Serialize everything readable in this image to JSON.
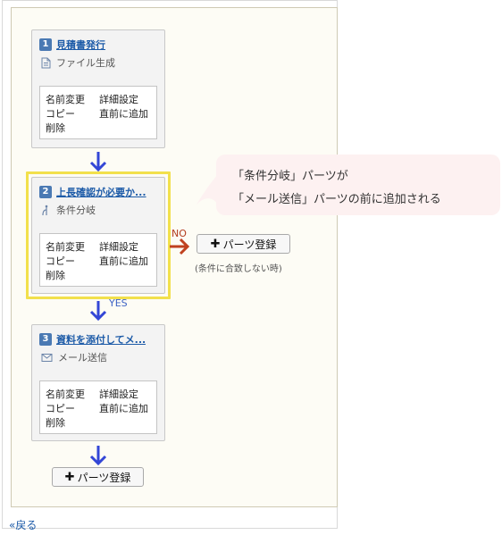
{
  "cards": [
    {
      "number": "1",
      "title": "見積書発行",
      "type_label": "ファイル生成",
      "type_icon": "document-icon"
    },
    {
      "number": "2",
      "title": "上長確認が必要か...",
      "type_label": "条件分岐",
      "type_icon": "branch-icon"
    },
    {
      "number": "3",
      "title": "資料を添付してメ...",
      "type_label": "メール送信",
      "type_icon": "envelope-icon"
    }
  ],
  "ops": {
    "rename": "名前変更",
    "details": "詳細設定",
    "copy": "コピー",
    "add_before": "直前に追加",
    "delete": "削除"
  },
  "branch": {
    "yes_label": "YES",
    "no_label": "NO",
    "no_button": "パーツ登録",
    "no_note": "(条件に合致しない時)"
  },
  "bottom_button": "パーツ登録",
  "callout": {
    "line1": "「条件分岐」パーツが",
    "line2": "「メール送信」パーツの前に追加される"
  },
  "back_link": "«戻る",
  "colors": {
    "arrow_blue": "#3346d6",
    "arrow_red": "#c0411f",
    "highlight": "#f2e04c",
    "callout_bg": "#fdf1f1"
  }
}
